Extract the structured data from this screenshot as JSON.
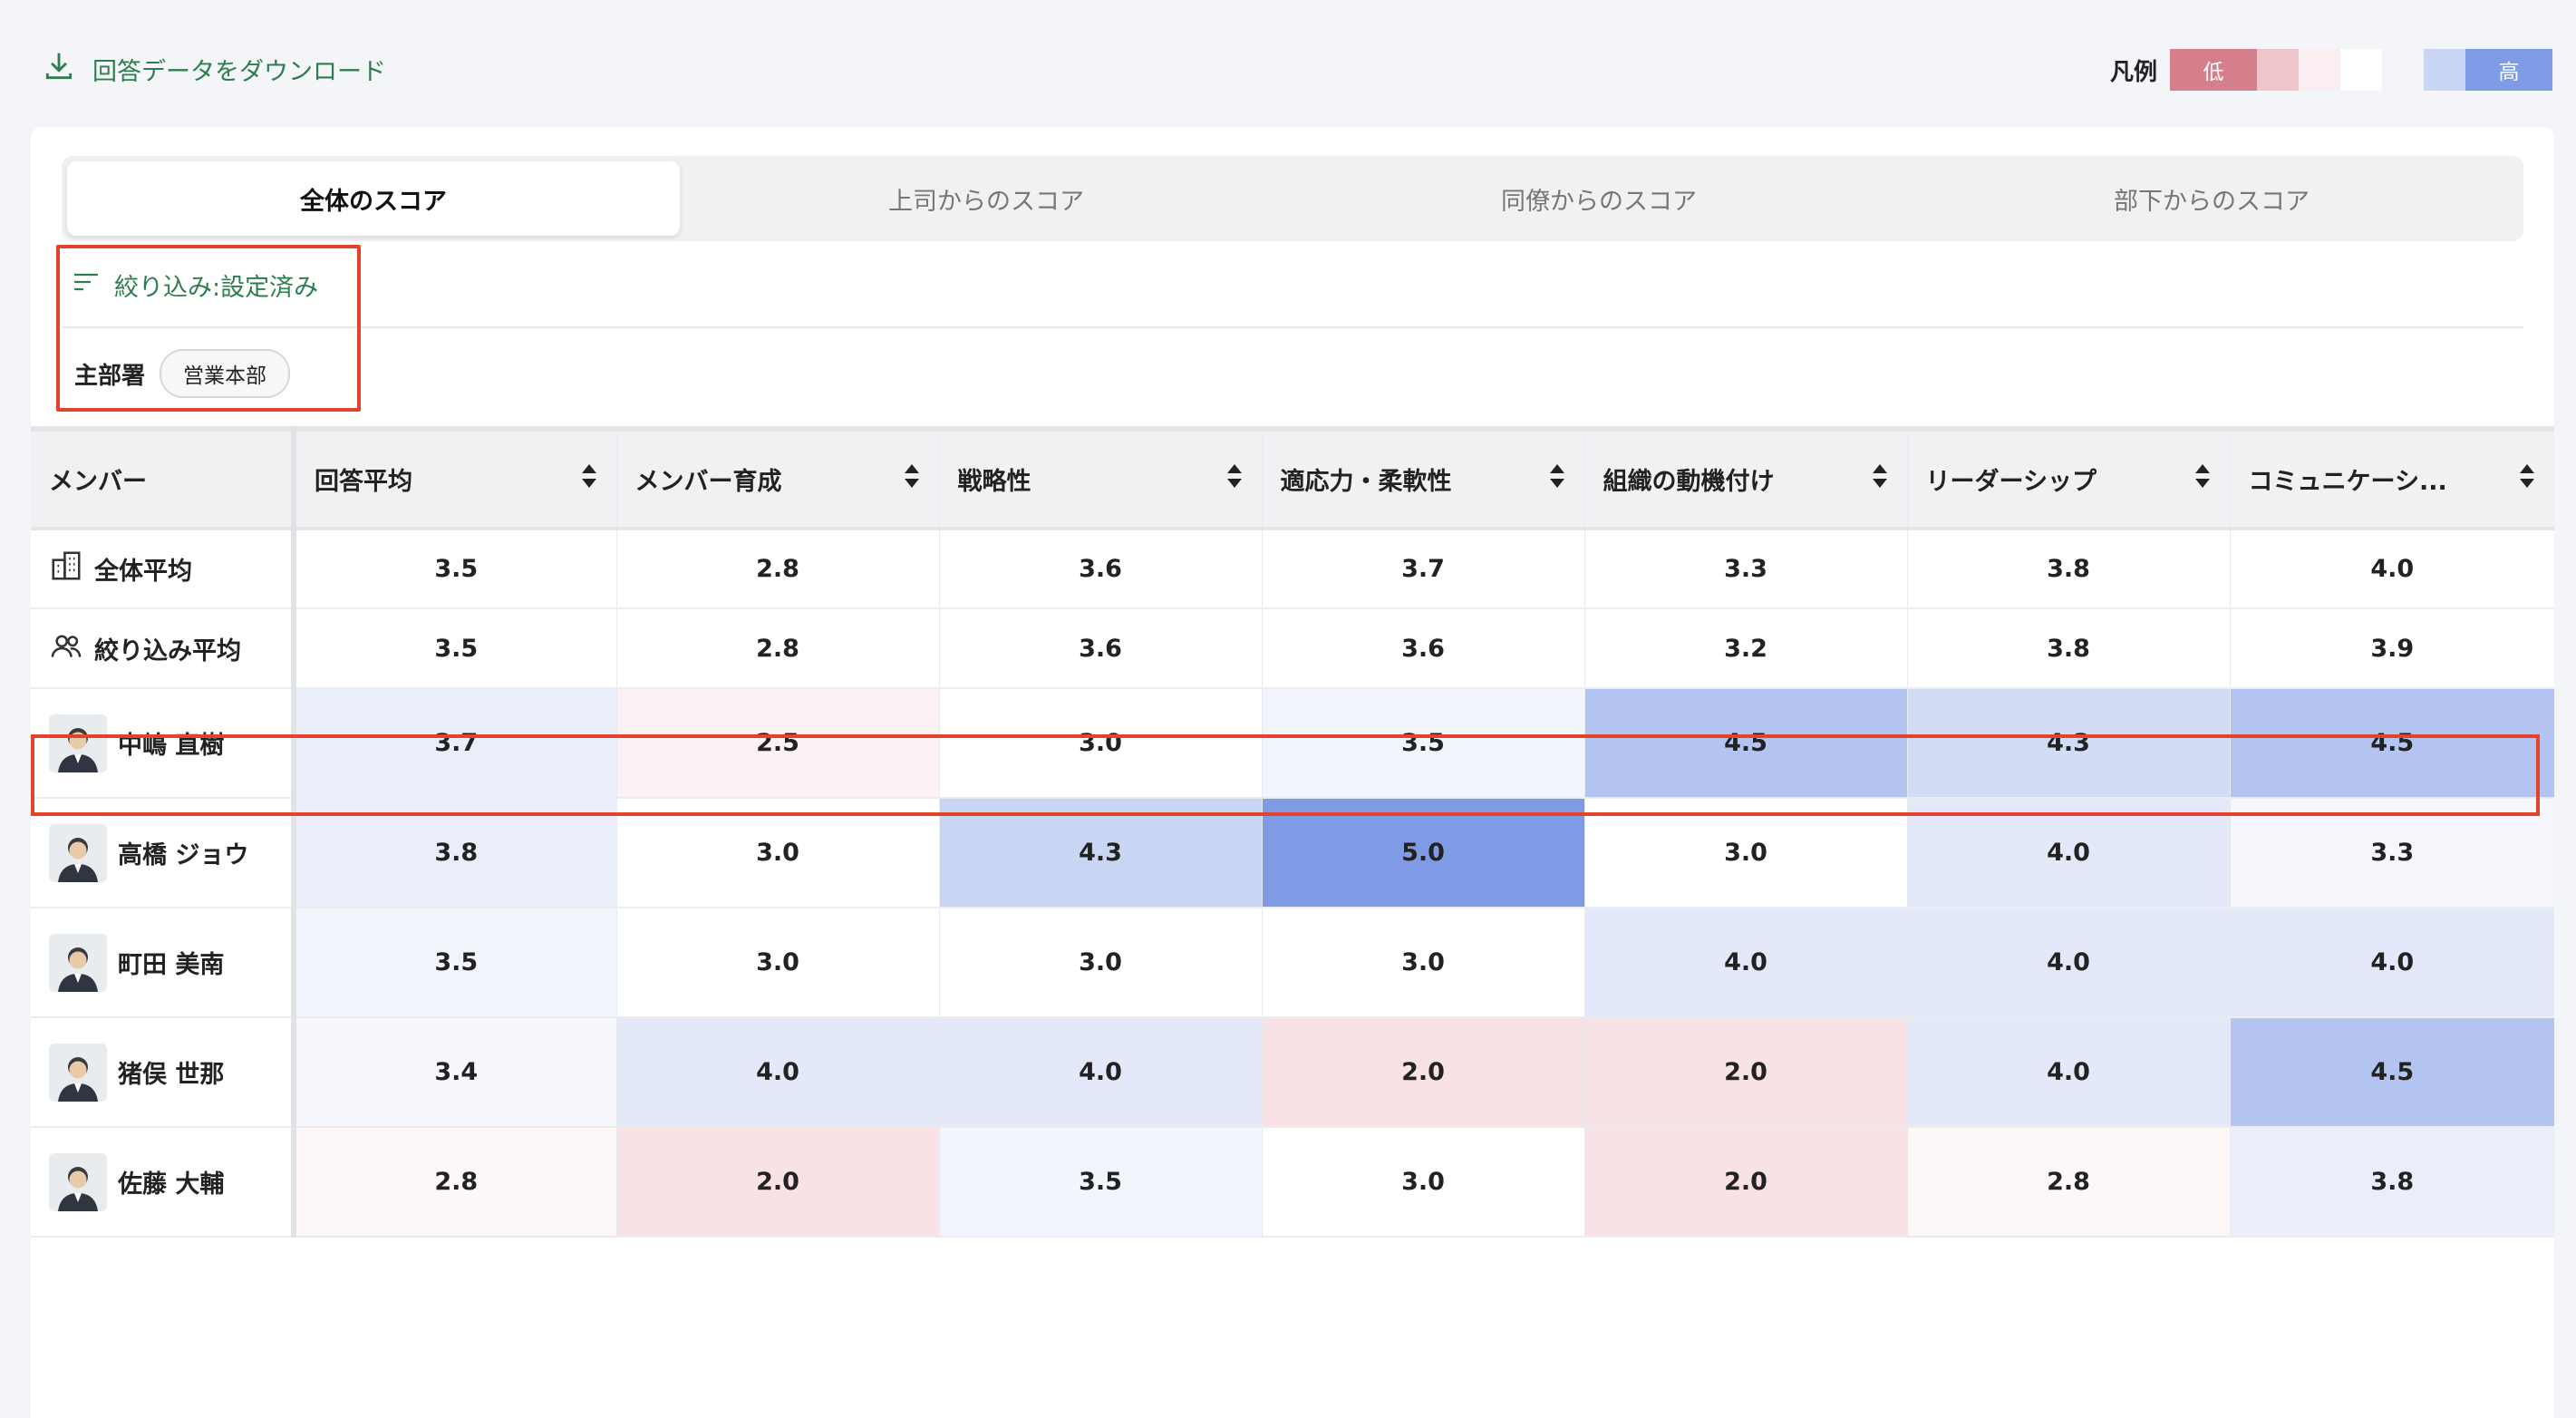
{
  "top": {
    "download_label": "回答データをダウンロード",
    "legend_label": "凡例",
    "legend_low": "低",
    "legend_high": "高",
    "legend_colors": [
      "#d47f8b",
      "#eec5ca",
      "#fbeef0",
      "#ffffff",
      "#f4f5f8",
      "#c9d6f4",
      "#7f9be6"
    ]
  },
  "tabs": [
    {
      "label": "全体のスコア",
      "active": true
    },
    {
      "label": "上司からのスコア",
      "active": false
    },
    {
      "label": "同僚からのスコア",
      "active": false
    },
    {
      "label": "部下からのスコア",
      "active": false
    }
  ],
  "filter": {
    "toggle_label": "絞り込み:設定済み",
    "dept_label": "主部署",
    "dept_value": "営業本部"
  },
  "table": {
    "columns": [
      "メンバー",
      "回答平均",
      "メンバー育成",
      "戦略性",
      "適応力・柔軟性",
      "組織の動機付け",
      "リーダーシップ",
      "コミュニケーシ..."
    ],
    "overall_avg": {
      "label": "全体平均",
      "values": [
        "3.5",
        "2.8",
        "3.6",
        "3.7",
        "3.3",
        "3.8",
        "4.0"
      ]
    },
    "filtered_avg": {
      "label": "絞り込み平均",
      "values": [
        "3.5",
        "2.8",
        "3.6",
        "3.6",
        "3.2",
        "3.8",
        "3.9"
      ]
    },
    "members": [
      {
        "name": "中嶋 直樹",
        "values": [
          "3.7",
          "2.5",
          "3.0",
          "3.5",
          "4.5",
          "4.3",
          "4.5"
        ]
      },
      {
        "name": "高橋 ジョウ",
        "values": [
          "3.8",
          "3.0",
          "4.3",
          "5.0",
          "3.0",
          "4.0",
          "3.3"
        ]
      },
      {
        "name": "町田 美南",
        "values": [
          "3.5",
          "3.0",
          "3.0",
          "3.0",
          "4.0",
          "4.0",
          "4.0"
        ]
      },
      {
        "name": "猪俣 世那",
        "values": [
          "3.4",
          "4.0",
          "4.0",
          "2.0",
          "2.0",
          "4.0",
          "4.5"
        ]
      },
      {
        "name": "佐藤 大輔",
        "values": [
          "2.8",
          "2.0",
          "3.5",
          "3.0",
          "2.0",
          "2.8",
          "3.8"
        ]
      }
    ],
    "cell_colors": [
      [
        "#eaeefb",
        "#fdf2f3",
        "#ffffff",
        "#f2f5fc",
        "#b3c4f0",
        "#d2dcf5",
        "#b3c4f0"
      ],
      [
        "#eaeefb",
        "#ffffff",
        "#c8d5f3",
        "#7f9be6",
        "#ffffff",
        "#e3e9f8",
        "#f5f7fc"
      ],
      [
        "#f2f5fc",
        "#ffffff",
        "#ffffff",
        "#ffffff",
        "#e3e9f8",
        "#e3e9f8",
        "#e3e9f8"
      ],
      [
        "#f5f7fc",
        "#e3e9f8",
        "#e3e9f8",
        "#f8e2e5",
        "#f8e2e5",
        "#e3e9f8",
        "#b3c4f0"
      ],
      [
        "#fdf7f8",
        "#f8e2e5",
        "#f2f5fc",
        "#ffffff",
        "#f8e2e5",
        "#fdf7f8",
        "#eaeefb"
      ]
    ]
  }
}
